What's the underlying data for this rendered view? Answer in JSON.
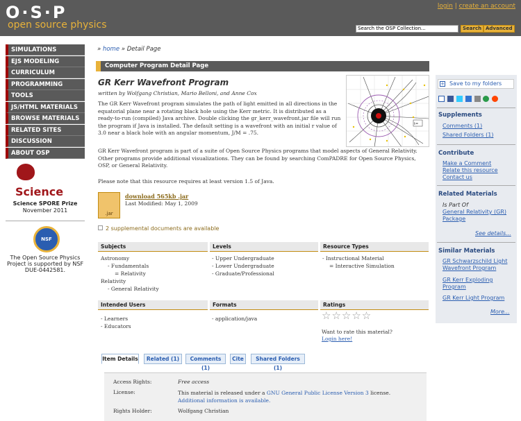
{
  "header": {
    "logo": "O·S·P",
    "subtitle": "open source physics",
    "login": "login",
    "separator": "|",
    "create_account": "create an account",
    "search_value": "Search the OSP Collection...",
    "search_button": "Search",
    "advanced_button": "Advanced"
  },
  "nav": {
    "items": [
      "SIMULATIONS",
      "EJS MODELING",
      "CURRICULUM",
      "PROGRAMMING",
      "TOOLS",
      "JS/HTML MATERIALS",
      "BROWSE MATERIALS",
      "RELATED SITES",
      "DISCUSSION",
      "ABOUT OSP"
    ]
  },
  "award": {
    "logo_text": "Science",
    "prize": "Science SPORE Prize",
    "date": "November 2011"
  },
  "nsf": {
    "logo_text": "NSF",
    "text": "The Open Source Physics Project is supported by NSF DUE-0442581."
  },
  "breadcrumb": {
    "arrow": "»",
    "home": "home",
    "arrow2": "»",
    "current": "Detail Page"
  },
  "section_bar": "Computer Program Detail Page",
  "resource": {
    "title": "GR Kerr Wavefront Program",
    "authors": "written by Wolfgang Christian, Mario Belloni, and Anne Cox",
    "desc1": "The GR Kerr Wavefront program simulates the path of light emitted in all directions in the equatorial plane near a rotating black hole using the Kerr metric.  It is distributed as a ready-to-run (compiled) Java archive.  Double clicking the gr_kerr_wavefront.jar file will run the program if Java is installed.  The default setting is a wavefront with an initial r value of 3.0 near a black hole with an angular momentum, J/M = .75.",
    "desc2": "GR Kerr Wavefront program is part of a suite of Open Source Physics programs that model aspects of General Relativity.  Other programs provide additional visualizations.  They can be found by searching ComPADRE for Open Source Physics, OSP, or General Relativity.",
    "desc3": "Please note that this resource requires at least version 1.5 of Java.",
    "fig_label": "t=",
    "jar_label": ".jar",
    "download": "download 565kb .jar",
    "last_modified": "Last Modified: May 1, 2009",
    "supplemental": "2 supplemental documents are available"
  },
  "meta": {
    "subjects_h": "Subjects",
    "levels_h": "Levels",
    "types_h": "Resource Types",
    "subjects": [
      "Astronomy",
      "- Fundamentals",
      "= Relativity",
      "Relativity",
      "- General Relativity"
    ],
    "levels": [
      "- Upper Undergraduate",
      "- Lower Undergraduate",
      "- Graduate/Professional"
    ],
    "types": [
      "- Instructional Material",
      "= Interactive Simulation"
    ],
    "users_h": "Intended Users",
    "formats_h": "Formats",
    "ratings_h": "Ratings",
    "users": [
      "- Learners",
      "- Educators"
    ],
    "formats": [
      "- application/java"
    ],
    "rating_stars": "☆☆☆☆☆",
    "rate_question": "Want to rate this material?",
    "rate_login": "Login here!"
  },
  "tabs": [
    "Item Details",
    "Related (1)",
    "Comments (1)",
    "Cite",
    "Shared Folders (1)"
  ],
  "details": {
    "access_label": "Access Rights:",
    "access_value": "Free access",
    "license_label": "License:",
    "license_pre": "This material is released under a ",
    "license_link": "GNU General Public License Version 3",
    "license_mid": " license. ",
    "license_more": "Additional information is available.",
    "holder_label": "Rights Holder:",
    "holder_value": "Wolfgang Christian"
  },
  "sidebar": {
    "save": "Save to my folders",
    "share_icons": [
      "plus-icon",
      "facebook-icon",
      "twitter-icon",
      "delicious-icon",
      "digg-icon",
      "stumbleupon-icon",
      "reddit-icon"
    ],
    "supplements_h": "Supplements",
    "comments": "Comments (1)",
    "shared": "Shared Folders (1)",
    "contribute_h": "Contribute",
    "make_comment": "Make a Comment",
    "relate": "Relate this resource",
    "contact": "Contact us",
    "related_h": "Related Materials",
    "ispartof": "Is Part Of",
    "gr_package": "General Relativity (GR) Package",
    "see_details": "See details...",
    "similar_h": "Similar Materials",
    "similar": [
      "GR Schwarzschild Light Wavefront Program",
      "GR Kerr Exploding Program",
      "GR Kerr Light Program"
    ],
    "more": "More..."
  },
  "colors": {
    "header_bg": "#5a5a5a",
    "accent": "#e8b23a",
    "nav_border": "#9f0606",
    "link": "#2a5db0"
  }
}
